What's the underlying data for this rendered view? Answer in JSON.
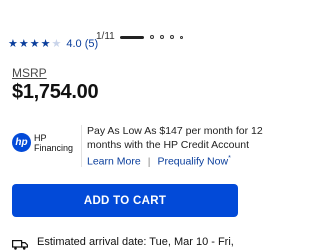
{
  "carousel": {
    "pager": "1/11",
    "active_index": 0,
    "dot_count": 5
  },
  "rating": {
    "value_text": "4.0 (5)",
    "stars_filled": 4,
    "stars_total": 5,
    "icon": "star-icon"
  },
  "pricing": {
    "msrp_label": "MSRP",
    "price": "$1,754.00"
  },
  "financing": {
    "brand_line1": "HP",
    "brand_line2": "Financing",
    "logo_text": "hp",
    "line1": "Pay As Low As $147 per month for 12",
    "line2": "months with the HP Credit Account",
    "learn_more": "Learn More",
    "separator": "|",
    "prequalify": "Prequalify Now",
    "prequalify_mark": "*"
  },
  "cart": {
    "add_to_cart_label": "ADD TO CART"
  },
  "delivery": {
    "arrival_text": "Estimated arrival date: Tue, Mar 10 - Fri,",
    "icon": "truck-icon"
  },
  "colors": {
    "brand_blue": "#024ad8",
    "link_blue": "#0a3e9c"
  }
}
